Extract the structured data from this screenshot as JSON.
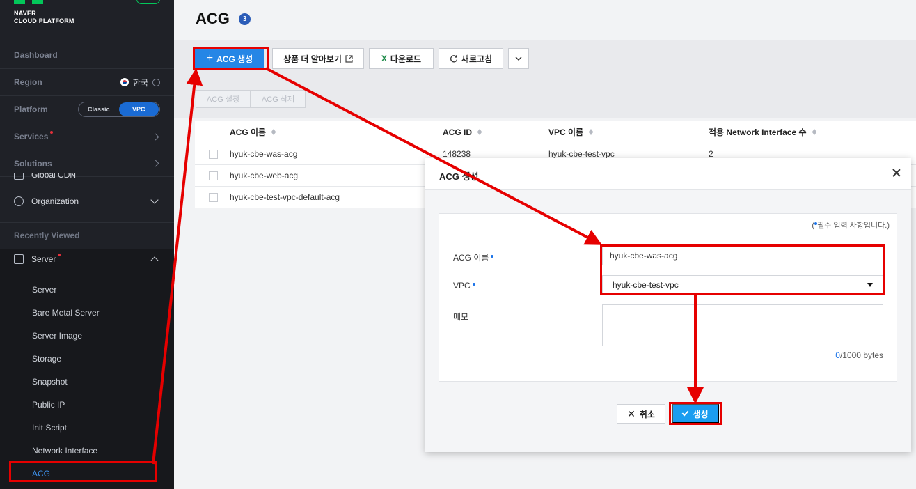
{
  "sidebar": {
    "logo_line1": "NAVER",
    "logo_line2": "CLOUD PLATFORM",
    "dashboard": "Dashboard",
    "region_label": "Region",
    "region_value": "한국",
    "platform_label": "Platform",
    "platform_options": [
      "Classic",
      "VPC"
    ],
    "platform_selected": "VPC",
    "services": "Services",
    "solutions": "Solutions",
    "global_cdn": "Global CDN",
    "organization": "Organization",
    "recently_viewed": "Recently Viewed",
    "server_group": "Server",
    "items": [
      "Server",
      "Bare Metal Server",
      "Server Image",
      "Storage",
      "Snapshot",
      "Public IP",
      "Init Script",
      "Network Interface",
      "ACG"
    ],
    "active_item": "ACG"
  },
  "main": {
    "title": "ACG",
    "count": "3",
    "toolbar": {
      "create": "ACG 생성",
      "learn_more": "상품 더 알아보기",
      "download": "다운로드",
      "refresh": "새로고침"
    },
    "actions": {
      "settings": "ACG 설정",
      "delete": "ACG 삭제"
    },
    "table": {
      "columns": [
        "ACG 이름",
        "ACG ID",
        "VPC 이름",
        "적용 Network Interface 수"
      ],
      "rows": [
        [
          "hyuk-cbe-was-acg",
          "148238",
          "hyuk-cbe-test-vpc",
          "2"
        ],
        [
          "hyuk-cbe-web-acg",
          "",
          "",
          ""
        ],
        [
          "hyuk-cbe-test-vpc-default-acg",
          "",
          "",
          ""
        ]
      ]
    }
  },
  "modal": {
    "title": "ACG 생성",
    "required_note_prefix": "(",
    "required_note": "필수 입력 사항입니다.)",
    "name_label": "ACG 이름",
    "name_value": "hyuk-cbe-was-acg",
    "vpc_label": "VPC",
    "vpc_value": "hyuk-cbe-test-vpc",
    "memo_label": "메모",
    "bytes_used": "0",
    "bytes_limit": "/1000 bytes",
    "cancel": "취소",
    "create": "생성"
  },
  "colors": {
    "annotation_red": "#e60000",
    "primary_blue": "#2586e6",
    "sidebar_bg": "#1f2127",
    "active_link": "#3d8fe8"
  }
}
